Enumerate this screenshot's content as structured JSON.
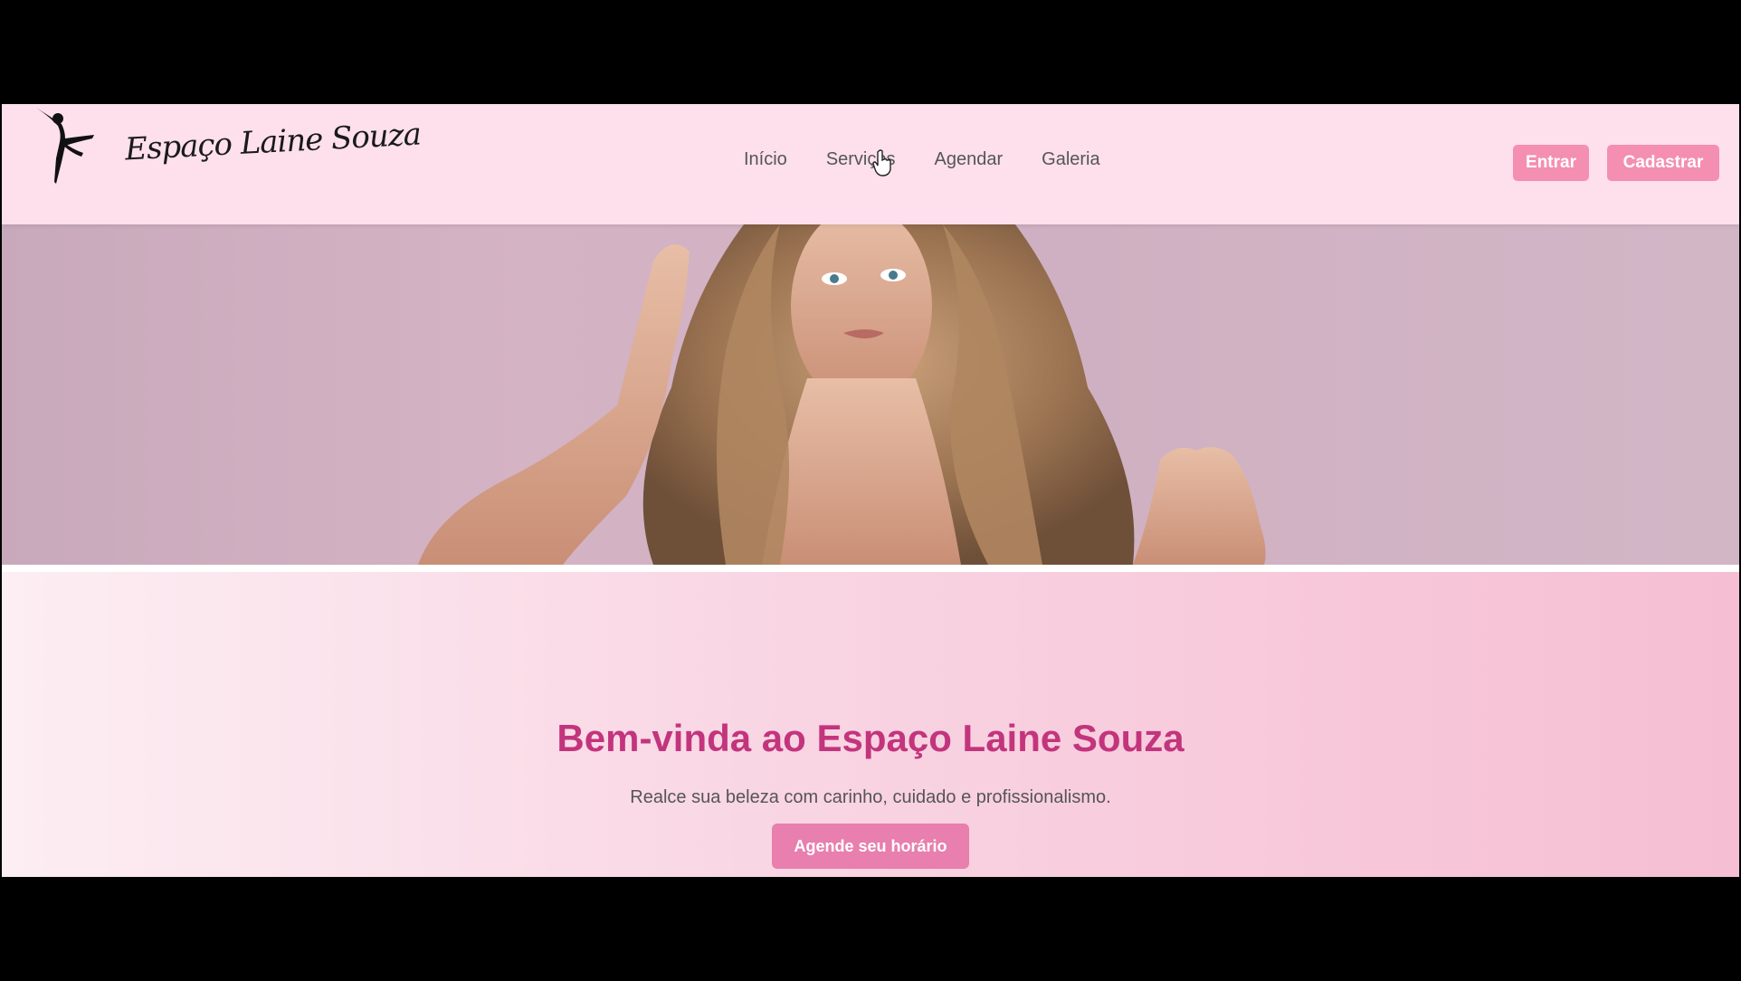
{
  "header": {
    "logo_text": "Espaço Laine Souza",
    "nav": [
      "Início",
      "Serviços",
      "Agendar",
      "Galeria"
    ],
    "login_label": "Entrar",
    "signup_label": "Cadastrar"
  },
  "hero": {
    "image": "woman-long-wavy-hair-photo"
  },
  "welcome": {
    "title": "Bem-vinda ao Espaço Laine Souza",
    "subtitle": "Realce sua beleza com carinho, cuidado e profissionalismo.",
    "cta_label": "Agende seu horário"
  },
  "colors": {
    "header_bg": "#fde0ec",
    "accent": "#f48fb1",
    "title": "#c2357d",
    "cta": "#e87fae"
  },
  "icons": {
    "logo": "dancer-silhouette-icon",
    "cursor": "hand-pointer-icon"
  }
}
